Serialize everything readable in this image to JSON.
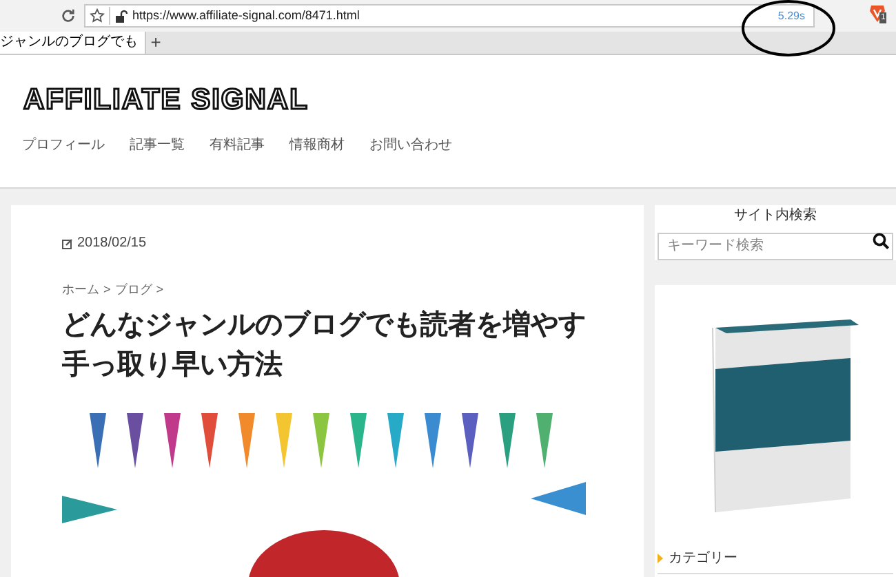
{
  "browser": {
    "url": "https://www.affiliate-signal.com/8471.html",
    "load_time": "5.29s",
    "extension_badge": "1",
    "tab_title": "ジャンルのブログでも",
    "new_tab": "+"
  },
  "site": {
    "logo": "AFFILIATE SIGNAL",
    "nav": [
      {
        "label": "プロフィール"
      },
      {
        "label": "記事一覧"
      },
      {
        "label": "有料記事"
      },
      {
        "label": "情報商材"
      },
      {
        "label": "お問い合わせ"
      }
    ]
  },
  "article": {
    "date": "2018/02/15",
    "breadcrumb": [
      {
        "label": "ホーム",
        "separator": ">"
      },
      {
        "label": "ブログ",
        "separator": ">"
      }
    ],
    "title": "どんなジャンルのブログでも読者を増やす手っ取り早い方法"
  },
  "sidebar": {
    "search_title": "サイト内検索",
    "search": {
      "placeholder": "キーワード検索"
    },
    "category_heading": "カテゴリー"
  }
}
